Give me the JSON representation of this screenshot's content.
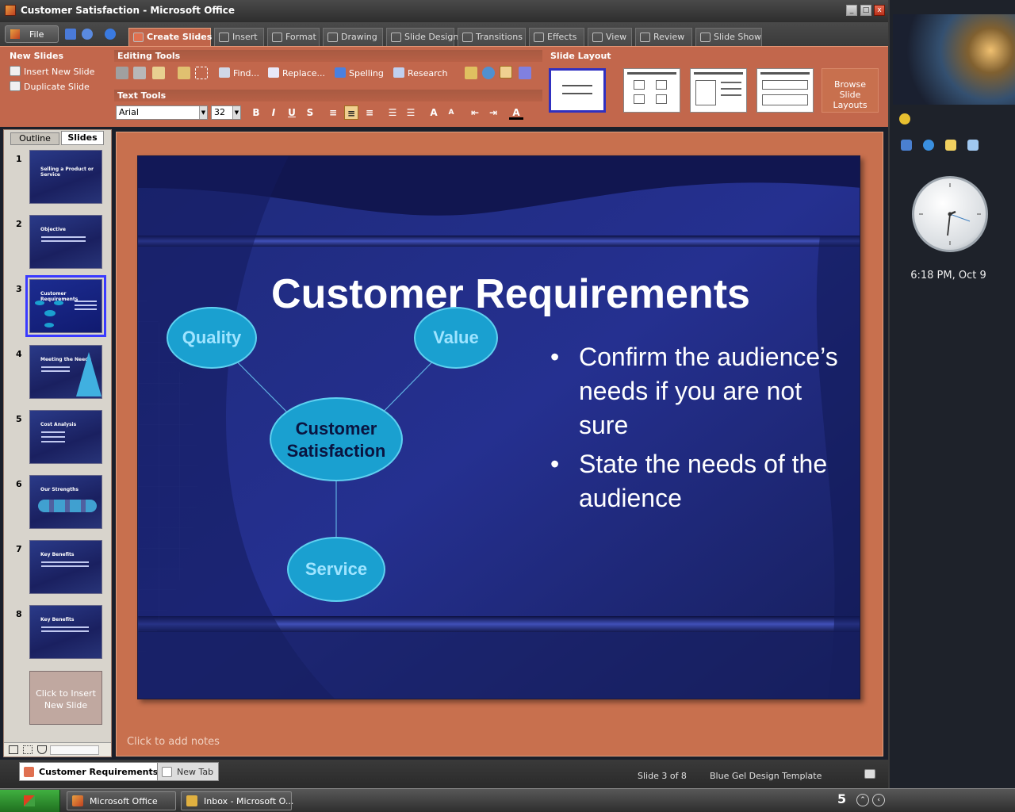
{
  "window": {
    "title": "Customer Satisfaction - Microsoft Office",
    "controls": {
      "minimize": "_",
      "maximize": "□",
      "close": "x"
    }
  },
  "menu": {
    "file_label": "File",
    "tabs": [
      {
        "label": "Create Slides",
        "icon": "create-slides-icon",
        "active": true
      },
      {
        "label": "Insert",
        "icon": "insert-icon"
      },
      {
        "label": "Format",
        "icon": "format-icon"
      },
      {
        "label": "Drawing",
        "icon": "drawing-icon"
      },
      {
        "label": "Slide Design",
        "icon": "slide-design-icon"
      },
      {
        "label": "Transitions",
        "icon": "transitions-icon"
      },
      {
        "label": "Effects",
        "icon": "effects-icon"
      },
      {
        "label": "View",
        "icon": "view-icon"
      },
      {
        "label": "Review",
        "icon": "review-icon"
      },
      {
        "label": "Slide Show",
        "icon": "slide-show-icon"
      }
    ]
  },
  "ribbon": {
    "new_slides": {
      "title": "New Slides",
      "insert_new_slide": "Insert New Slide",
      "duplicate_slide": "Duplicate Slide"
    },
    "editing_tools": {
      "title": "Editing Tools",
      "find": "Find...",
      "replace": "Replace...",
      "spelling": "Spelling",
      "research": "Research"
    },
    "text_tools": {
      "title": "Text Tools",
      "font": "Arial",
      "size": "32",
      "bold": "B",
      "italic": "I",
      "underline": "U",
      "shadow": "S"
    },
    "slide_layout": {
      "title": "Slide Layout",
      "browse": "Browse Slide Layouts"
    }
  },
  "slide_panel": {
    "tab_outline": "Outline",
    "tab_slides": "Slides",
    "thumbnails": [
      {
        "num": "1",
        "title": "Selling a Product or Service"
      },
      {
        "num": "2",
        "title": "Objective"
      },
      {
        "num": "3",
        "title": "Customer Requirements",
        "selected": true
      },
      {
        "num": "4",
        "title": "Meeting the Needs"
      },
      {
        "num": "5",
        "title": "Cost Analysis"
      },
      {
        "num": "6",
        "title": "Our Strengths"
      },
      {
        "num": "7",
        "title": "Key Benefits"
      },
      {
        "num": "8",
        "title": "Key Benefits"
      }
    ],
    "insert_new": "Click to Insert New Slide"
  },
  "slide": {
    "title": "Customer Requirements",
    "bubbles": {
      "quality": "Quality",
      "value": "Value",
      "center": "Customer Satisfaction",
      "service": "Service"
    },
    "bullets": [
      "Confirm the audience’s needs if you are not sure",
      "State the needs of the audience"
    ]
  },
  "notes_placeholder": "Click to add notes",
  "status": {
    "doc_tab": "Customer Requirements",
    "new_tab": "New Tab",
    "slide_indicator": "Slide 3 of 8",
    "template": "Blue Gel Design Template"
  },
  "taskbar": {
    "tasks": [
      {
        "label": "Microsoft Office",
        "icon": "office-icon"
      },
      {
        "label": "Inbox - Microsoft O...",
        "icon": "outlook-icon"
      }
    ],
    "tray_time": "5"
  },
  "sidebar": {
    "clock_text": "6:18 PM, Oct 9"
  },
  "colors": {
    "ribbon": "#c2674c",
    "slide_bg": "#1c2470",
    "bubble": "#1aa0d0",
    "bubble_text": "#9fe4ff",
    "accent_selection": "#3a3aff"
  }
}
